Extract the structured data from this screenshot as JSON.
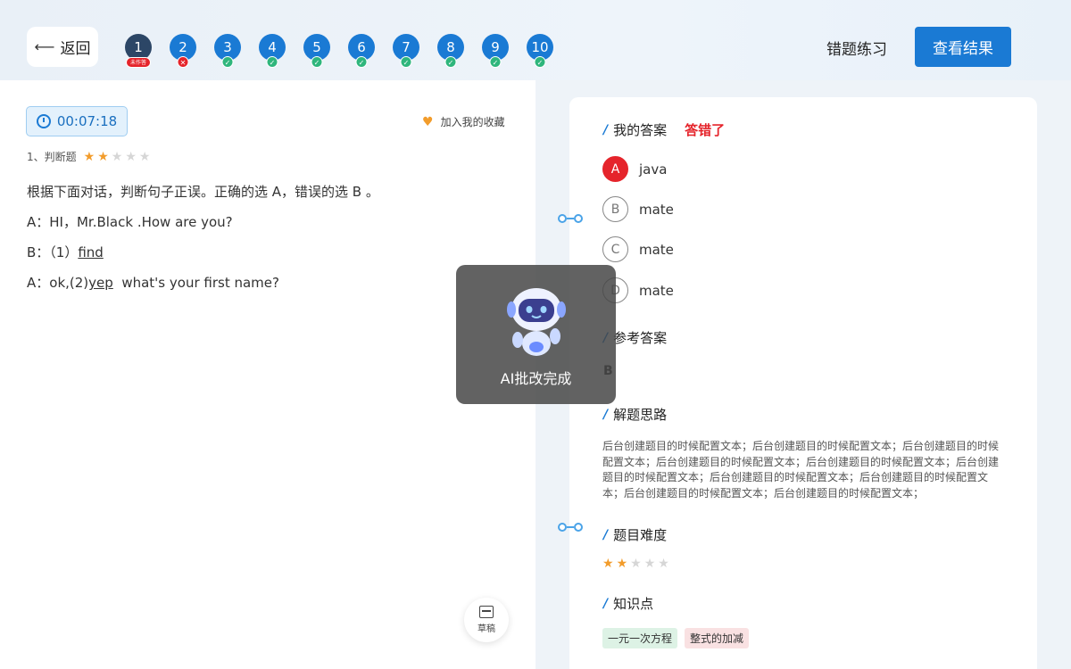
{
  "header": {
    "back_label": "返回",
    "practice_title": "错题练习",
    "view_result_label": "查看结果",
    "questions": [
      {
        "num": "1",
        "status": "未作答"
      },
      {
        "num": "2",
        "status": "✕"
      },
      {
        "num": "3",
        "status": "✓"
      },
      {
        "num": "4",
        "status": "✓"
      },
      {
        "num": "5",
        "status": "✓"
      },
      {
        "num": "6",
        "status": "✓"
      },
      {
        "num": "7",
        "status": "✓"
      },
      {
        "num": "8",
        "status": "✓"
      },
      {
        "num": "9",
        "status": "✓"
      },
      {
        "num": "10",
        "status": "✓"
      }
    ]
  },
  "left": {
    "timer": "00:07:18",
    "favorite_label": "加入我的收藏",
    "question_type": "1、判断题",
    "difficulty_stars": 2,
    "instruction": "根据下面对话，判断句子正误。正确的选 A，错误的选 B 。",
    "line1": "A：HI，Mr.Black .How are  you?",
    "line2_prefix": "B：（1）",
    "line2_blank": "find",
    "line3_prefix": "A：ok,(2)",
    "line3_blank": "yep",
    "line3_suffix": "  what's your first name?",
    "draft_label": "草稿"
  },
  "overlay": {
    "text": "AI批改完成"
  },
  "right": {
    "my_answer_title": "我的答案",
    "wrong_label": "答错了",
    "options": [
      {
        "letter": "A",
        "text": "java"
      },
      {
        "letter": "B",
        "text": "mate"
      },
      {
        "letter": "C",
        "text": "mate"
      },
      {
        "letter": "D",
        "text": "mate"
      }
    ],
    "reference_title": "参考答案",
    "reference_answer": "B",
    "analysis_title": "解题思路",
    "analysis_text": "后台创建题目的时候配置文本；后台创建题目的时候配置文本；后台创建题目的时候配置文本；后台创建题目的时候配置文本；后台创建题目的时候配置文本；后台创建题目的时候配置文本；后台创建题目的时候配置文本；后台创建题目的时候配置文本；后台创建题目的时候配置文本；后台创建题目的时候配置文本；",
    "difficulty_title": "题目难度",
    "difficulty_stars": 2,
    "knowledge_title": "知识点",
    "tags": [
      "一元一次方程",
      "整式的加减"
    ]
  },
  "colors": {
    "primary": "#1a7ad4",
    "wrong": "#e5242b",
    "correct": "#2fb67c",
    "star": "#f29c2b"
  }
}
